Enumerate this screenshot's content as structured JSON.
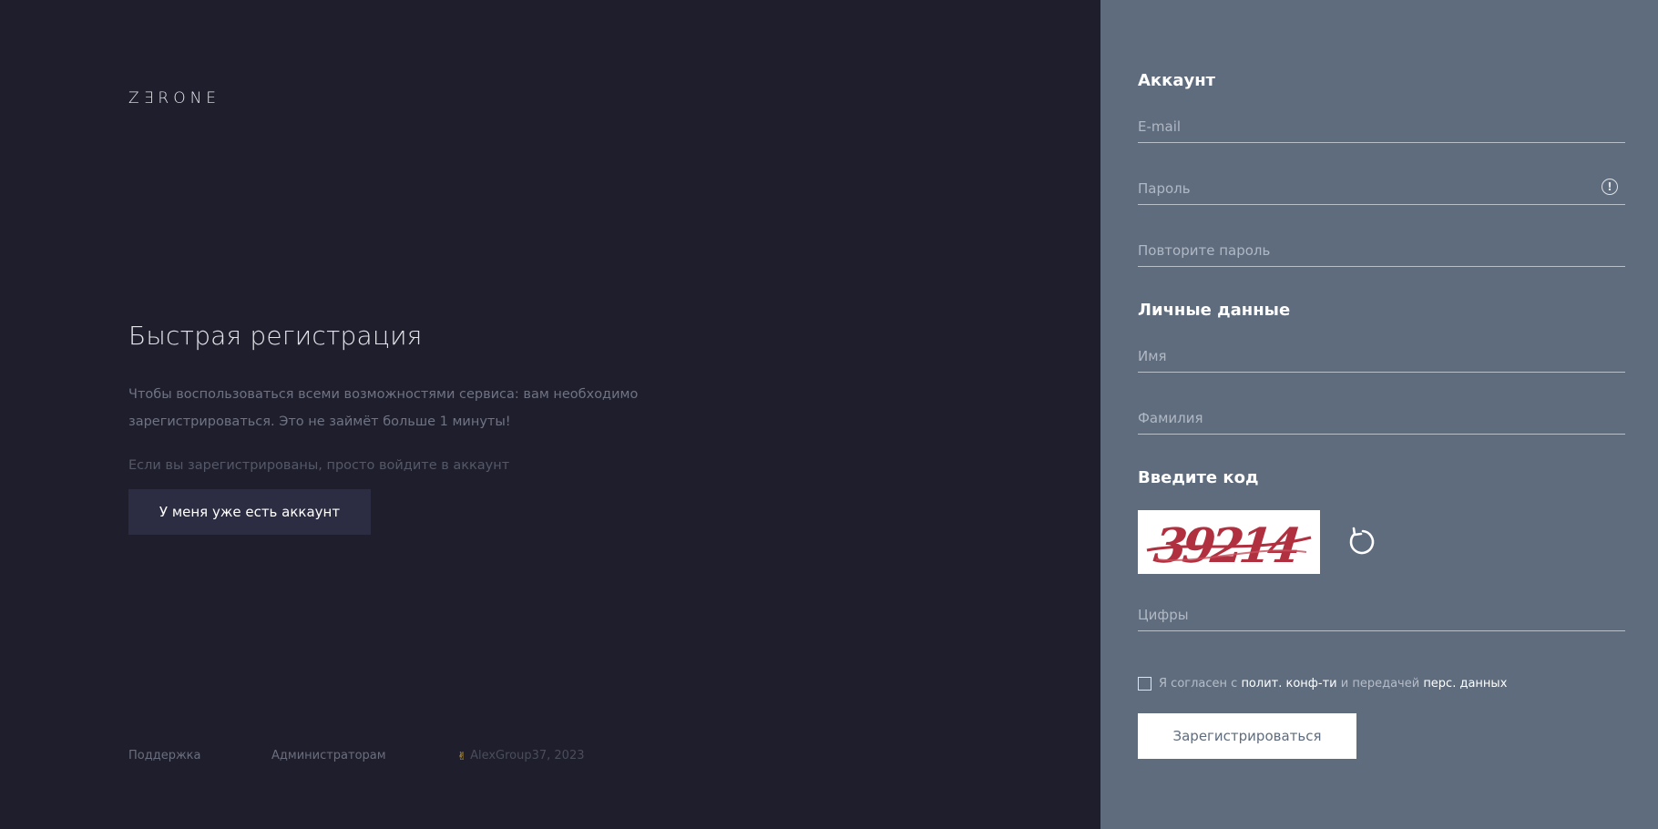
{
  "brand": {
    "logo": "ZƎRONE"
  },
  "intro": {
    "heading": "Быстрая регистрация",
    "description_line1": "Чтобы воспользоваться всеми возможностями сервиса: вам необходимо",
    "description_line2": "зарегистрироваться. Это не займёт больше 1 минуты!",
    "login_hint": "Если вы зарегистрированы, просто войдите в аккаунт",
    "login_button": "У меня уже есть аккаунт"
  },
  "footer": {
    "support": "Поддержка",
    "admins": "Администраторам",
    "copyright": "AlexGroup37, 2023",
    "copyright_icon": "rock-hand-icon"
  },
  "form": {
    "account_title": "Аккаунт",
    "email_placeholder": "E-mail",
    "password_placeholder": "Пароль",
    "password_info_icon": "exclamation-circle-icon",
    "repeat_password_placeholder": "Повторите пароль",
    "personal_title": "Личные данные",
    "first_name_placeholder": "Имя",
    "last_name_placeholder": "Фамилия",
    "code_title": "Введите код",
    "captcha_text": "39214",
    "refresh_icon": "refresh-icon",
    "digits_placeholder": "Цифры",
    "agree": {
      "prefix": "Я согласен с ",
      "privacy_link": "полит. конф-ти",
      "middle": " и передачей ",
      "data_link": "перс. данных"
    },
    "register_button": "Зарегистрироваться"
  },
  "colors": {
    "left_bg": "#1e1e2c",
    "right_bg": "#5f6c7d",
    "login_button_bg": "#2c2d42",
    "captcha_red": "#b0303f"
  }
}
